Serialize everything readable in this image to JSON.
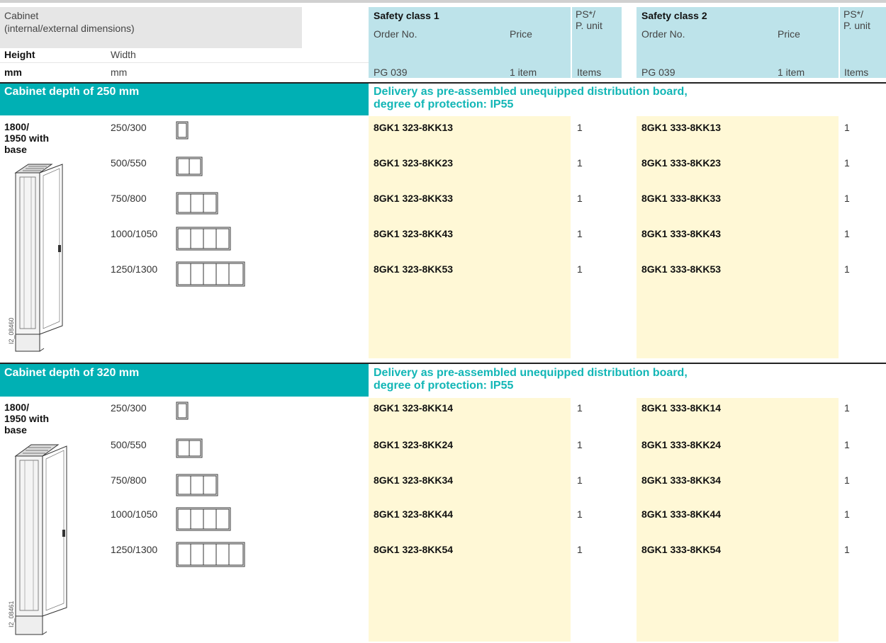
{
  "header": {
    "cabinet_label": "Cabinet",
    "cabinet_sub": "(internal/external dimensions)",
    "height_label": "Height",
    "width_label": "Width",
    "height_unit": "mm",
    "width_unit": "mm",
    "sc1_title": "Safety class 1",
    "sc2_title": "Safety class 2",
    "order_no": "Order No.",
    "price": "Price",
    "ps_line1": "PS*/",
    "ps_line2": "P. unit",
    "pg": "PG 039",
    "price_unit": "1 item",
    "items": "Items"
  },
  "sections": [
    {
      "title": "Cabinet depth of 250 mm",
      "delivery_line1": "Delivery as pre-assembled unequipped distribution board,",
      "delivery_line2": "degree of protection: IP55",
      "height_line1": "1800/",
      "height_line2": "1950 with",
      "height_line3": "base",
      "image_ref": "I2_08460",
      "rows": [
        {
          "width": "250/300",
          "sc1": "8GK1 323-8KK13",
          "ps1": "1",
          "sc2": "8GK1 333-8KK13",
          "ps2": "1"
        },
        {
          "width": "500/550",
          "sc1": "8GK1 323-8KK23",
          "ps1": "1",
          "sc2": "8GK1 333-8KK23",
          "ps2": "1"
        },
        {
          "width": "750/800",
          "sc1": "8GK1 323-8KK33",
          "ps1": "1",
          "sc2": "8GK1 333-8KK33",
          "ps2": "1"
        },
        {
          "width": "1000/1050",
          "sc1": "8GK1 323-8KK43",
          "ps1": "1",
          "sc2": "8GK1 333-8KK43",
          "ps2": "1"
        },
        {
          "width": "1250/1300",
          "sc1": "8GK1 323-8KK53",
          "ps1": "1",
          "sc2": "8GK1 333-8KK53",
          "ps2": "1"
        }
      ]
    },
    {
      "title": "Cabinet depth of 320 mm",
      "delivery_line1": "Delivery as pre-assembled unequipped distribution board,",
      "delivery_line2": "degree of protection: IP55",
      "height_line1": "1800/",
      "height_line2": "1950 with",
      "height_line3": "base",
      "image_ref": "I2_08461",
      "rows": [
        {
          "width": "250/300",
          "sc1": "8GK1 323-8KK14",
          "ps1": "1",
          "sc2": "8GK1 333-8KK14",
          "ps2": "1"
        },
        {
          "width": "500/550",
          "sc1": "8GK1 323-8KK24",
          "ps1": "1",
          "sc2": "8GK1 333-8KK24",
          "ps2": "1"
        },
        {
          "width": "750/800",
          "sc1": "8GK1 323-8KK34",
          "ps1": "1",
          "sc2": "8GK1 333-8KK34",
          "ps2": "1"
        },
        {
          "width": "1000/1050",
          "sc1": "8GK1 323-8KK44",
          "ps1": "1",
          "sc2": "8GK1 333-8KK44",
          "ps2": "1"
        },
        {
          "width": "1250/1300",
          "sc1": "8GK1 323-8KK54",
          "ps1": "1",
          "sc2": "8GK1 333-8KK54",
          "ps2": "1"
        }
      ]
    }
  ]
}
